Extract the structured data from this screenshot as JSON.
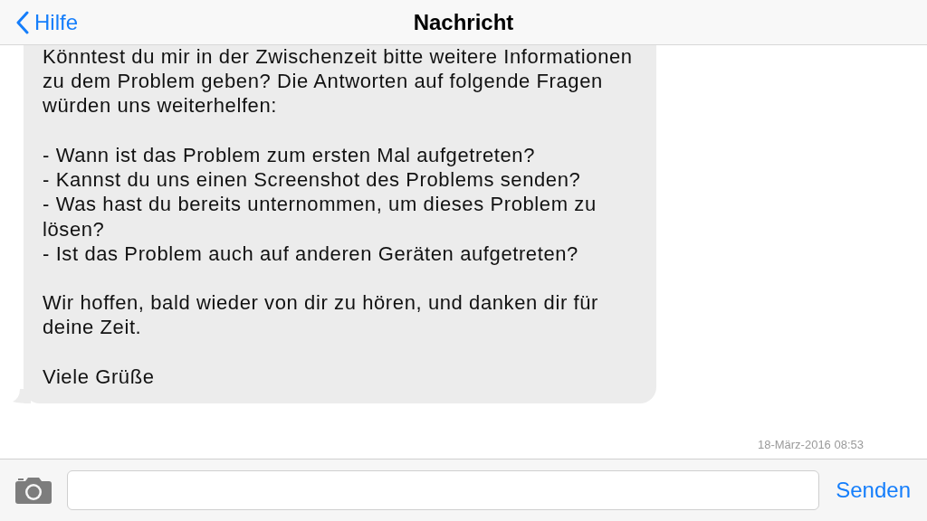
{
  "nav_bar": {
    "back_label": "Hilfe",
    "title": "Nachricht"
  },
  "message": {
    "blocks": [
      [
        "Könntest du mir in der Zwischenzeit bitte weitere Informationen zu dem Problem geben? Die Antworten auf folgende Fragen würden uns weiterhelfen:"
      ],
      [
        "- Wann ist das Problem zum ersten Mal aufgetreten?",
        "- Kannst du uns einen Screenshot des Problems senden?",
        "- Was hast du bereits unternommen, um dieses Problem zu lösen?",
        "- Ist das Problem auch auf anderen Geräten aufgetreten?"
      ],
      [
        "Wir hoffen, bald wieder von dir zu hören, und danken dir für deine Zeit."
      ],
      [
        "Viele Grüße"
      ]
    ]
  },
  "timestamp": "18-März-2016 08:53",
  "composer": {
    "send_label": "Senden"
  }
}
